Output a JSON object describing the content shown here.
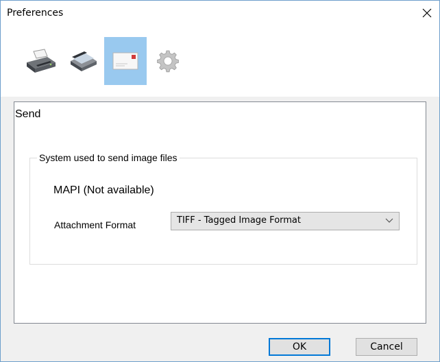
{
  "window": {
    "title": "Preferences"
  },
  "toolbar": {
    "items": [
      {
        "icon": "printer-icon",
        "selected": false
      },
      {
        "icon": "scanner-icon",
        "selected": false
      },
      {
        "icon": "email-icon",
        "selected": true
      },
      {
        "icon": "gear-icon",
        "selected": false
      }
    ]
  },
  "panel": {
    "title": "Send",
    "group": {
      "legend": "System used to send image files",
      "status": "MAPI (Not available)",
      "attachment_label": "Attachment Format",
      "attachment_value": "TIFF - Tagged Image Format"
    }
  },
  "buttons": {
    "ok": "OK",
    "cancel": "Cancel"
  },
  "colors": {
    "selected_tab": "#99c9ef",
    "default_button_border": "#0078d7",
    "window_border": "#6d9ecb"
  }
}
